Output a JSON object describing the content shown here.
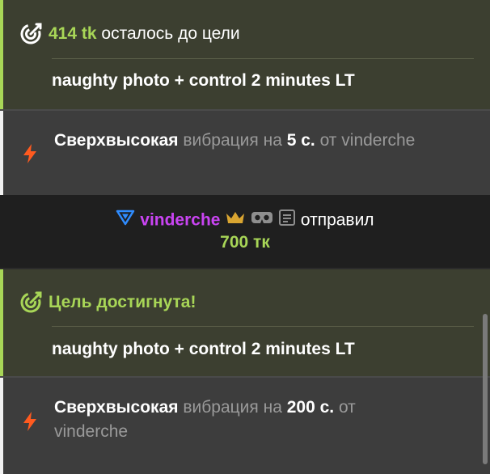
{
  "goal_progress": {
    "amount": "414 tk",
    "remaining_text": "осталось до цели",
    "goal_title": "naughty photo + control 2 minutes LT"
  },
  "tip1": {
    "level": "Сверхвысокая",
    "mid": "вибрация на",
    "duration": "5 с.",
    "from": "от",
    "user": "vinderche"
  },
  "sent": {
    "user": "vinderche",
    "verb": "отправил",
    "amount": "700 тк"
  },
  "goal_reached": {
    "text": "Цель достигнута!",
    "goal_title": "naughty photo + control 2 minutes LT"
  },
  "tip2": {
    "level": "Сверхвысокая",
    "mid": "вибрация на",
    "duration": "200 с.",
    "from": "от",
    "user": "vinderche"
  },
  "colors": {
    "accent_green": "#a8d657",
    "username_purple": "#c944f2",
    "lightning_orange": "#ff5a1f",
    "chevron_blue": "#2f8cff",
    "crown_gold": "#d9a531"
  },
  "icons": [
    "target-icon",
    "lightning-icon",
    "chevron-down-icon",
    "crown-icon",
    "vr-headset-icon",
    "notes-icon"
  ]
}
